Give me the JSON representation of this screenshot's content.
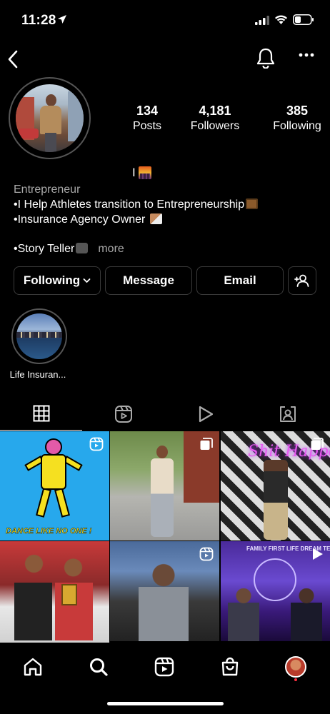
{
  "status_bar": {
    "time": "11:28",
    "icons": [
      "location-arrow-icon",
      "cellular-signal-icon",
      "wifi-icon",
      "battery-icon"
    ]
  },
  "top_nav": {
    "icons": [
      "back-chevron-icon",
      "bell-icon",
      "more-horizontal-icon"
    ]
  },
  "profile": {
    "name_text": "I",
    "stats": {
      "posts_value": "134",
      "posts_label": "Posts",
      "followers_value": "4,181",
      "followers_label": "Followers",
      "following_value": "385",
      "following_label": "Following"
    },
    "bio": {
      "category": "Entrepreneur",
      "line1": "•I Help Athletes transition to Entrepreneurship",
      "line2": "•Insurance Agency Owner ",
      "line3": "•Story Teller",
      "more": "more"
    }
  },
  "actions": {
    "following_label": "Following",
    "message_label": "Message",
    "email_label": "Email"
  },
  "highlights": [
    {
      "label": "Life Insuran..."
    }
  ],
  "tabs": [
    "grid-icon",
    "reels-icon",
    "play-icon",
    "tagged-icon"
  ],
  "posts": [
    {
      "type": "reel",
      "overlay_text": "DANCE LIKE NO ONE !"
    },
    {
      "type": "carousel"
    },
    {
      "type": "carousel",
      "overlay_text": "Shit Happens"
    },
    {
      "type": "photo"
    },
    {
      "type": "reel"
    },
    {
      "type": "video",
      "overlay_text": "FAMILY FIRST LIFE DREAM TEAM"
    }
  ],
  "bottom_nav": [
    "home-icon",
    "search-icon",
    "reels-icon",
    "shop-icon",
    "profile-avatar"
  ],
  "colors": {
    "background": "#000000",
    "secondary_text": "#a8a8a8",
    "button_border": "#3a3a3a",
    "notification_dot": "#ff3040"
  }
}
